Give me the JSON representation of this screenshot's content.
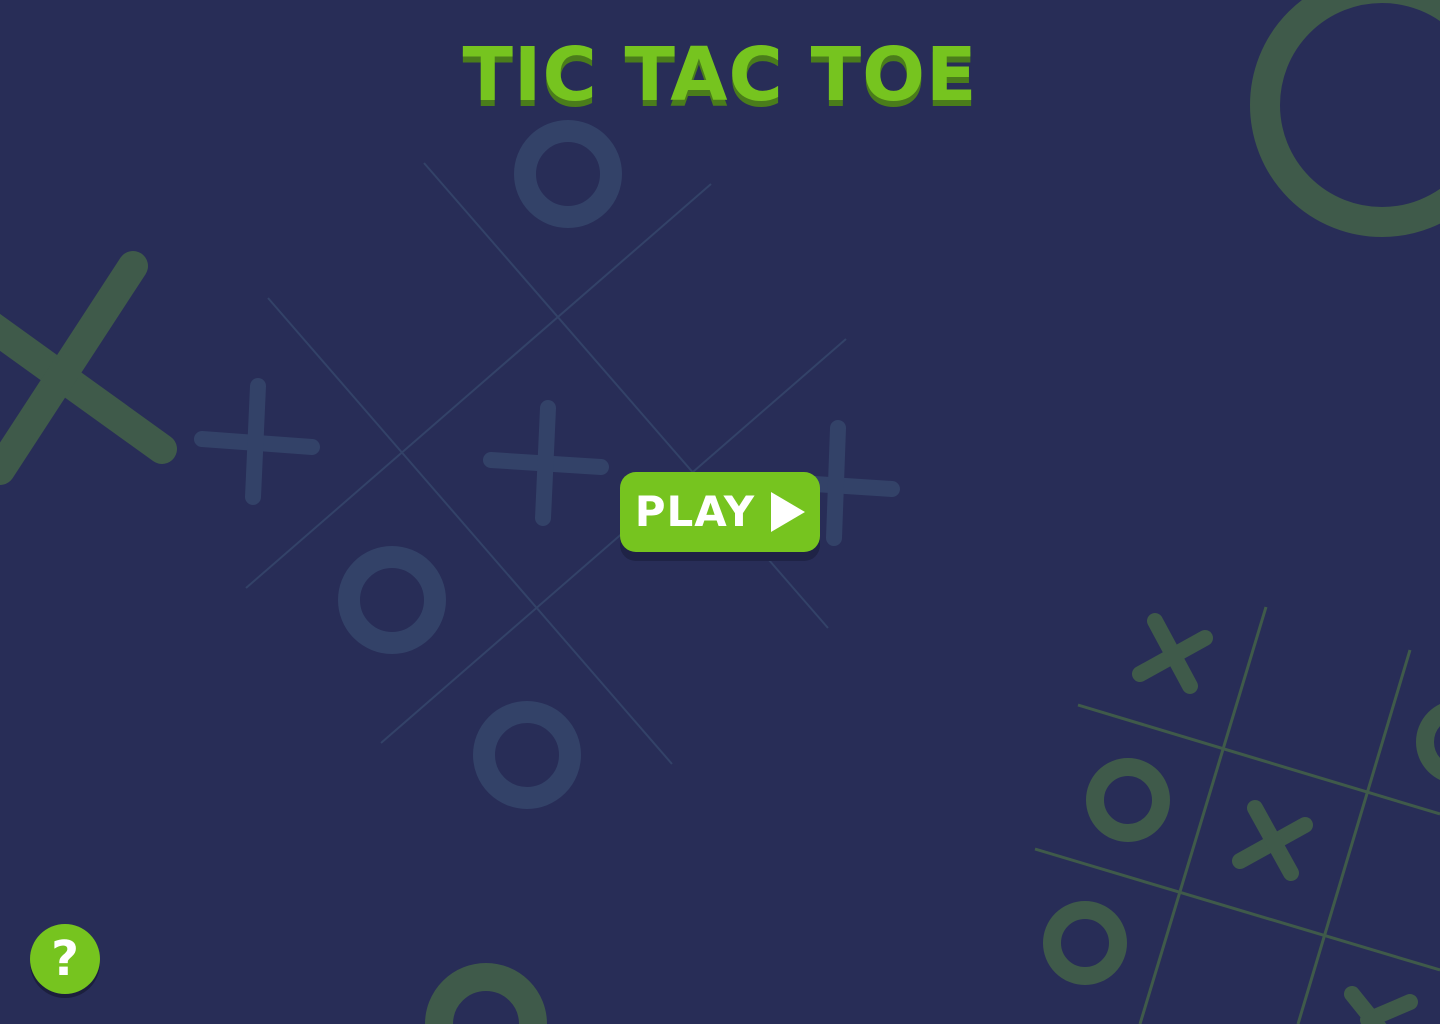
{
  "title": "TIC TAC TOE",
  "play_button": {
    "label": "PLAY",
    "icon": "play-triangle-icon"
  },
  "help_button": {
    "label": "?",
    "icon": "question-mark-icon"
  },
  "colors": {
    "background": "#282d57",
    "accent": "#76c41f",
    "decor": "#3f5a4a",
    "decor_faint": "#334268"
  }
}
